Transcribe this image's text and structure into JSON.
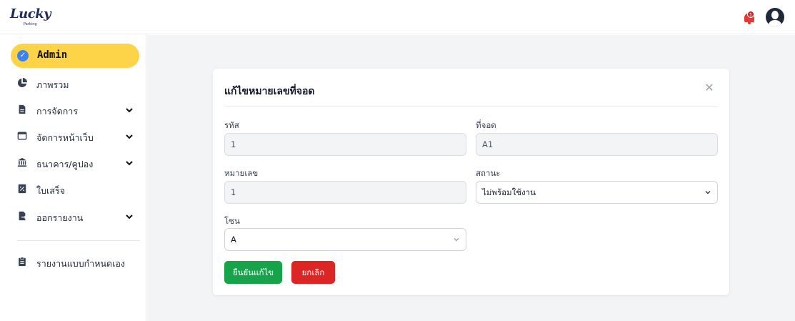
{
  "brand": {
    "name": "Lucky",
    "tagline": "Parking"
  },
  "header": {
    "notification_count": "1"
  },
  "sidebar": {
    "admin_label": "Admin",
    "items": [
      {
        "label": "ภาพรวม",
        "icon": "pie-chart-icon",
        "expandable": false
      },
      {
        "label": "การจัดการ",
        "icon": "document-icon",
        "expandable": true
      },
      {
        "label": "จัดการหน้าเว็บ",
        "icon": "window-icon",
        "expandable": true
      },
      {
        "label": "ธนาคาร/คูปอง",
        "icon": "bank-icon",
        "expandable": true
      },
      {
        "label": "ใบเสร็จ",
        "icon": "receipt-icon",
        "expandable": false
      },
      {
        "label": "ออกรายงาน",
        "icon": "file-export-icon",
        "expandable": true
      }
    ],
    "custom_report": {
      "label": "รายงานแบบกำหนดเอง",
      "icon": "clipboard-icon"
    }
  },
  "modal": {
    "title": "แก้ไขหมายเลขที่จอด",
    "fields": {
      "code": {
        "label": "รหัส",
        "value": "1"
      },
      "spot": {
        "label": "ที่จอด",
        "value": "A1"
      },
      "number": {
        "label": "หมายเลข",
        "value": "1"
      },
      "status": {
        "label": "สถานะ",
        "value": "ไม่พร้อมใช้งาน"
      },
      "zone": {
        "label": "โซน",
        "value": "A"
      }
    },
    "confirm_label": "ยืนยันแก้ไข",
    "cancel_label": "ยกเลิก"
  },
  "colors": {
    "accent_yellow": "#fdd447",
    "confirm_green": "#16a34a",
    "cancel_red": "#dc2626",
    "notification_red": "#e53935"
  }
}
